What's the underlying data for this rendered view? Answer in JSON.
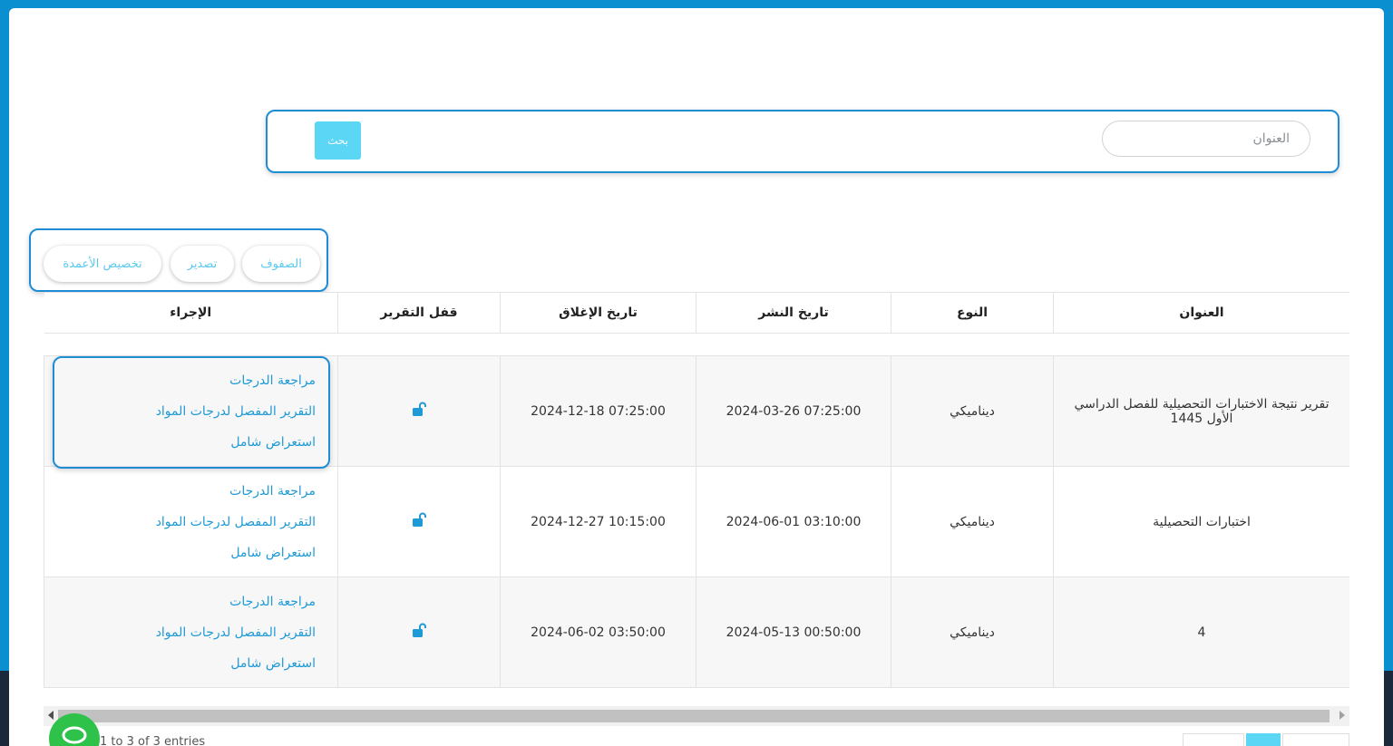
{
  "search": {
    "placeholder": "العنوان",
    "button_label": "بحث"
  },
  "toolbar": {
    "rows_label": "الصفوف",
    "export_label": "تصدير",
    "columns_label": "تخصيص الأعمدة"
  },
  "table": {
    "headers": [
      "العنوان",
      "النوع",
      "تاريخ النشر",
      "تاريخ الإغلاق",
      "قفل التقرير",
      "الإجراء"
    ],
    "rows": [
      {
        "title": "تقرير نتيجة الاختبارات التحصيلية للفصل الدراسي الأول 1445",
        "type": "ديناميكي",
        "publish_date": "07:25:00 2024-03-26",
        "close_date": "07:25:00 2024-12-18"
      },
      {
        "title": "اختبارات التحصيلية",
        "type": "ديناميكي",
        "publish_date": "03:10:00 2024-06-01",
        "close_date": "10:15:00 2024-12-27"
      },
      {
        "title": "4",
        "type": "ديناميكي",
        "publish_date": "00:50:00 2024-05-13",
        "close_date": "03:50:00 2024-06-02"
      }
    ],
    "actions": [
      "مراجعة الدرجات",
      "التقرير المفصل لدرجات المواد",
      "استعراض شامل"
    ]
  },
  "footer": {
    "info": "1 to 3 of 3 entries"
  },
  "colors": {
    "accent": "#5bd6f5",
    "link": "#1e9ad6",
    "frame": "#0a8fd0",
    "chat": "#2ec24a"
  }
}
